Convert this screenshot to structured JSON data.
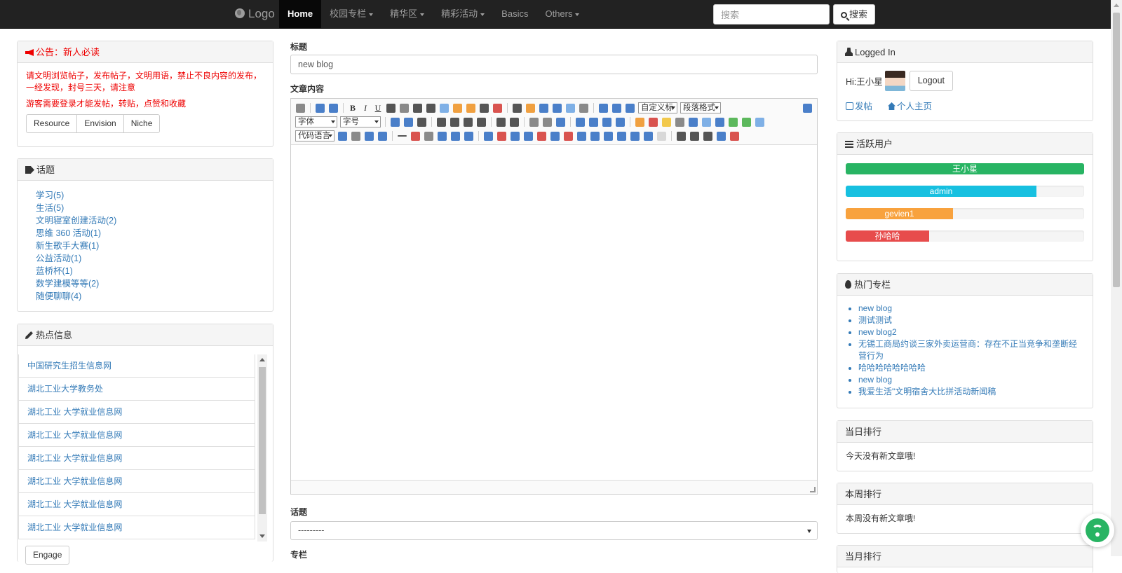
{
  "navbar": {
    "brand": "Logo",
    "items": [
      {
        "label": "Home",
        "dropdown": false,
        "active": true
      },
      {
        "label": "校园专栏",
        "dropdown": true
      },
      {
        "label": "精华区",
        "dropdown": true
      },
      {
        "label": "精彩活动",
        "dropdown": true
      },
      {
        "label": "Basics",
        "dropdown": false
      },
      {
        "label": "Others",
        "dropdown": true
      }
    ],
    "search_placeholder": "搜索",
    "search_button": "搜索"
  },
  "notice": {
    "title": "公告：新人必读",
    "line1": "请文明浏览帖子，发布帖子，文明用语，禁止不良内容的发布，一经发现，封号三天，请注意",
    "line2": "游客需要登录才能发帖，转贴，点赞和收藏",
    "buttons": [
      "Resource",
      "Envision",
      "Niche"
    ]
  },
  "topics": {
    "title": "话题",
    "items": [
      "学习(5)",
      "生活(5)",
      "文明寝室创建活动(2)",
      "思维 360 活动(1)",
      "新生歌手大赛(1)",
      "公益活动(1)",
      "蓝桥杯(1)",
      "数学建模等等(2)",
      "随便聊聊(4)"
    ]
  },
  "hot_info": {
    "title": "热点信息",
    "items": [
      "中国研究生招生信息网",
      "湖北工业大学教务处",
      "湖北工业 大学就业信息网",
      "湖北工业 大学就业信息网",
      "湖北工业 大学就业信息网",
      "湖北工业 大学就业信息网",
      "湖北工业 大学就业信息网",
      "湖北工业 大学就业信息网"
    ],
    "engage_button": "Engage"
  },
  "form": {
    "title_label": "标题",
    "title_value": "new blog",
    "content_label": "文章内容",
    "toolbar_selects": {
      "custom_title": "自定义标",
      "paragraph": "段落格式",
      "font": "字体",
      "size": "字号",
      "code": "代码语言"
    },
    "topic_label": "话题",
    "topic_value": "---------",
    "column_label": "专栏"
  },
  "login": {
    "title": "Logged In",
    "greeting": "Hi:王小星",
    "logout": "Logout",
    "post_link": "发帖",
    "home_link": "个人主页"
  },
  "active_users": {
    "title": "活跃用户",
    "users": [
      {
        "name": "王小星",
        "fraction": 1.0,
        "color": "#28b463"
      },
      {
        "name": "admin",
        "fraction": 0.8,
        "color": "#17c0e0"
      },
      {
        "name": "gevien1",
        "fraction": 0.45,
        "color": "#f8a23e"
      },
      {
        "name": "孙哈哈",
        "fraction": 0.35,
        "color": "#e74c4c"
      }
    ]
  },
  "hot_columns": {
    "title": "热门专栏",
    "items": [
      "new blog",
      "测试测试",
      "new blog2",
      "无锡工商局约谈三家外卖运营商：存在不正当竞争和垄断经营行为",
      "哈哈哈哈哈哈哈哈",
      "new blog",
      "我爱生活\"文明宿舍大比拼活动新闻稿"
    ]
  },
  "daily_rank": {
    "title": "当日排行",
    "text": "今天没有新文章哦!"
  },
  "weekly_rank": {
    "title": "本周排行",
    "text": "本周没有新文章哦!"
  },
  "bottom_rank": {
    "title": "当月排行"
  },
  "colors": {
    "navbar": "#222222",
    "link": "#337ab7",
    "notice": "#ee0000"
  }
}
